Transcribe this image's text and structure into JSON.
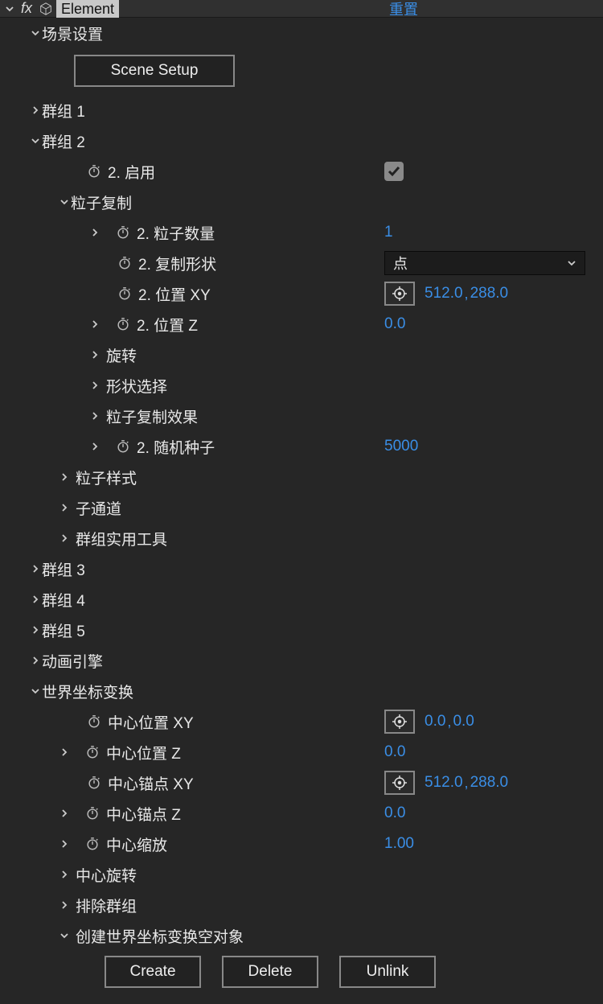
{
  "header": {
    "effect_name": "Element",
    "reset_label": "重置"
  },
  "sections": {
    "scene_settings": "场景设置",
    "scene_setup_btn": "Scene Setup",
    "group1": "群组 1",
    "group2": "群组 2",
    "enable_label": "2. 启用",
    "enable_checked": true,
    "particle_replicator": "粒子复制",
    "particle_count_label": "2. 粒子数量",
    "particle_count_value": "1",
    "replicate_shape_label": "2. 复制形状",
    "replicate_shape_value": "点",
    "position_xy_label": "2. 位置 XY",
    "position_xy_x": "512.0",
    "position_xy_y": "288.0",
    "position_z_label": "2. 位置 Z",
    "position_z_value": "0.0",
    "rotation": "旋转",
    "shape_select": "形状选择",
    "replicator_fx": "粒子复制效果",
    "random_seed_label": "2. 随机种子",
    "random_seed_value": "5000",
    "particle_style": "粒子样式",
    "aux_channel": "子通道",
    "group_utilities": "群组实用工具",
    "group3": "群组 3",
    "group4": "群组 4",
    "group5": "群组 5",
    "anim_engine": "动画引擎",
    "world_transform": "世界坐标变换",
    "center_pos_xy_label": "中心位置 XY",
    "center_pos_xy_x": "0.0",
    "center_pos_xy_y": "0.0",
    "center_pos_z_label": "中心位置 Z",
    "center_pos_z_value": "0.0",
    "center_anchor_xy_label": "中心锚点 XY",
    "center_anchor_xy_x": "512.0",
    "center_anchor_xy_y": "288.0",
    "center_anchor_z_label": "中心锚点 Z",
    "center_anchor_z_value": "0.0",
    "center_scale_label": "中心缩放",
    "center_scale_value": "1.00",
    "center_rotation": "中心旋转",
    "exclude_groups": "排除群组",
    "create_null": "创建世界坐标变换空对象",
    "btn_create": "Create",
    "btn_delete": "Delete",
    "btn_unlink": "Unlink"
  }
}
